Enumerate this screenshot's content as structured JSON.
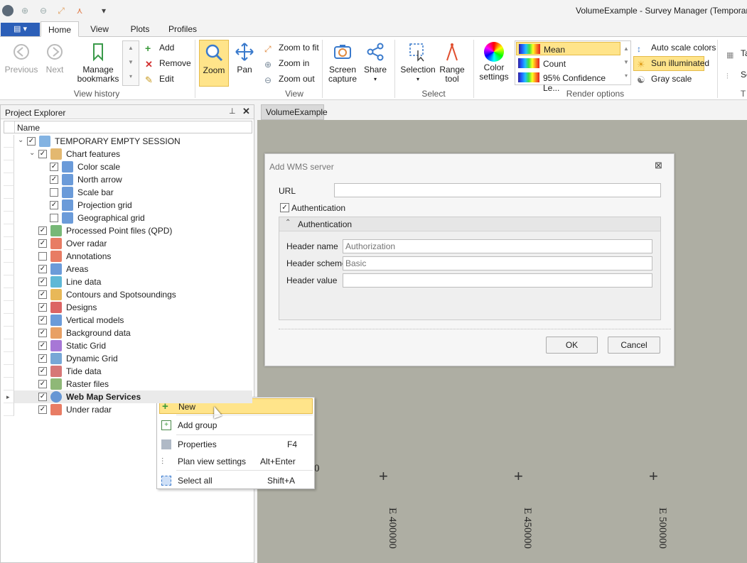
{
  "window": {
    "title": "VolumeExample - Survey Manager (Temporary Emp"
  },
  "tabs": [
    "Home",
    "View",
    "Plots",
    "Profiles"
  ],
  "ribbon": {
    "previous": "Previous",
    "next": "Next",
    "manage_bookmarks": "Manage bookmarks",
    "add": "Add",
    "remove": "Remove",
    "edit": "Edit",
    "view_history": "View history",
    "zoom": "Zoom",
    "pan": "Pan",
    "zoom_to_fit": "Zoom to fit",
    "zoom_in": "Zoom in",
    "zoom_out": "Zoom out",
    "view_group": "View",
    "screen_capture": "Screen capture",
    "share": "Share",
    "selection": "Selection",
    "range_tool": "Range tool",
    "select_group": "Select",
    "color_settings": "Color settings",
    "render_items": [
      "Mean",
      "Count",
      "95% Confidence Le..."
    ],
    "auto_scale_colors": "Auto scale colors",
    "sun_illuminated": "Sun illuminated",
    "gray_scale": "Gray scale",
    "render_options": "Render options",
    "cut1": "Ta",
    "cut2": "Se",
    "cut3": "T"
  },
  "explorer": {
    "title": "Project Explorer",
    "column": "Name",
    "items": [
      {
        "label": "TEMPORARY EMPTY SESSION",
        "checked": true,
        "level": 0
      },
      {
        "label": "Chart features",
        "checked": true,
        "level": 1
      },
      {
        "label": "Color scale",
        "checked": true,
        "level": 2
      },
      {
        "label": "North arrow",
        "checked": true,
        "level": 2
      },
      {
        "label": "Scale bar",
        "checked": false,
        "level": 2
      },
      {
        "label": "Projection grid",
        "checked": true,
        "level": 2
      },
      {
        "label": "Geographical grid",
        "checked": false,
        "level": 2
      },
      {
        "label": "Processed Point files (QPD)",
        "checked": true,
        "level": 1
      },
      {
        "label": "Over radar",
        "checked": true,
        "level": 1
      },
      {
        "label": "Annotations",
        "checked": false,
        "level": 1
      },
      {
        "label": "Areas",
        "checked": true,
        "level": 1
      },
      {
        "label": "Line data",
        "checked": true,
        "level": 1
      },
      {
        "label": "Contours and Spotsoundings",
        "checked": true,
        "level": 1
      },
      {
        "label": "Designs",
        "checked": true,
        "level": 1
      },
      {
        "label": "Vertical models",
        "checked": true,
        "level": 1
      },
      {
        "label": "Background data",
        "checked": true,
        "level": 1
      },
      {
        "label": "Static Grid",
        "checked": true,
        "level": 1
      },
      {
        "label": "Dynamic Grid",
        "checked": true,
        "level": 1
      },
      {
        "label": "Tide data",
        "checked": true,
        "level": 1
      },
      {
        "label": "Raster files",
        "checked": true,
        "level": 1
      },
      {
        "label": "Web Map Services",
        "checked": true,
        "level": 1
      },
      {
        "label": "Under radar",
        "checked": true,
        "level": 1
      }
    ]
  },
  "map": {
    "tab": "VolumeExample",
    "coords": [
      "E 400000",
      "E 450000",
      "E 500000"
    ],
    "partial_label": "0"
  },
  "dialog": {
    "title": "Add WMS server",
    "url_label": "URL",
    "url_value": "",
    "auth_checkbox": "Authentication",
    "auth_group": "Authentication",
    "header_name_label": "Header name",
    "header_name_placeholder": "Authorization",
    "header_scheme_label": "Header scheme",
    "header_scheme_placeholder": "Basic",
    "header_value_label": "Header value",
    "ok": "OK",
    "cancel": "Cancel"
  },
  "context_menu": {
    "new": "New",
    "add_group": "Add group",
    "properties": "Properties",
    "properties_key": "F4",
    "plan_view_settings": "Plan view settings",
    "plan_view_key": "Alt+Enter",
    "select_all": "Select all",
    "select_all_key": "Shift+A"
  }
}
